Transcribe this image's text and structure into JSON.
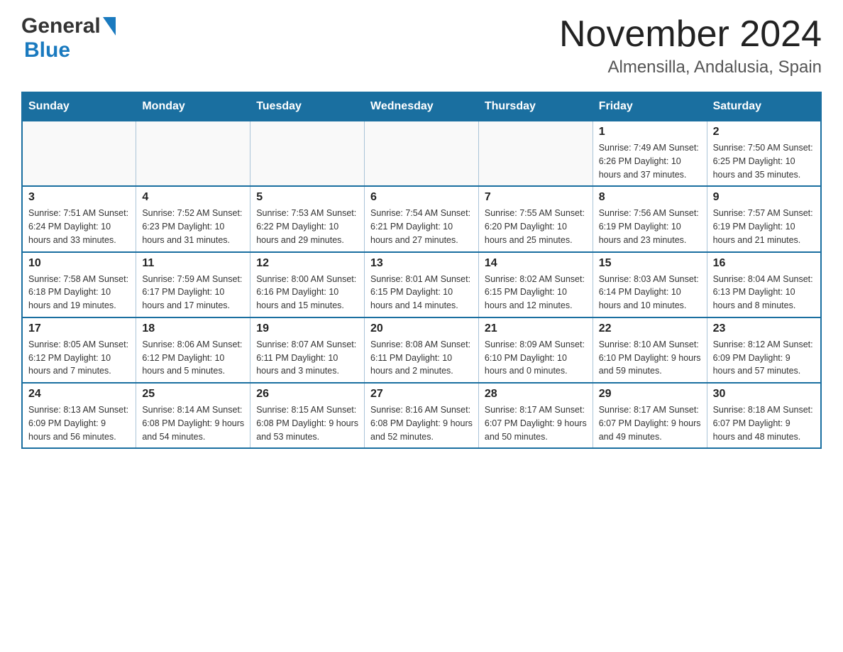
{
  "header": {
    "logo_general": "General",
    "logo_blue": "Blue",
    "title": "November 2024",
    "subtitle": "Almensilla, Andalusia, Spain"
  },
  "weekdays": [
    "Sunday",
    "Monday",
    "Tuesday",
    "Wednesday",
    "Thursday",
    "Friday",
    "Saturday"
  ],
  "weeks": [
    {
      "days": [
        {
          "number": "",
          "info": ""
        },
        {
          "number": "",
          "info": ""
        },
        {
          "number": "",
          "info": ""
        },
        {
          "number": "",
          "info": ""
        },
        {
          "number": "",
          "info": ""
        },
        {
          "number": "1",
          "info": "Sunrise: 7:49 AM\nSunset: 6:26 PM\nDaylight: 10 hours and 37 minutes."
        },
        {
          "number": "2",
          "info": "Sunrise: 7:50 AM\nSunset: 6:25 PM\nDaylight: 10 hours and 35 minutes."
        }
      ]
    },
    {
      "days": [
        {
          "number": "3",
          "info": "Sunrise: 7:51 AM\nSunset: 6:24 PM\nDaylight: 10 hours and 33 minutes."
        },
        {
          "number": "4",
          "info": "Sunrise: 7:52 AM\nSunset: 6:23 PM\nDaylight: 10 hours and 31 minutes."
        },
        {
          "number": "5",
          "info": "Sunrise: 7:53 AM\nSunset: 6:22 PM\nDaylight: 10 hours and 29 minutes."
        },
        {
          "number": "6",
          "info": "Sunrise: 7:54 AM\nSunset: 6:21 PM\nDaylight: 10 hours and 27 minutes."
        },
        {
          "number": "7",
          "info": "Sunrise: 7:55 AM\nSunset: 6:20 PM\nDaylight: 10 hours and 25 minutes."
        },
        {
          "number": "8",
          "info": "Sunrise: 7:56 AM\nSunset: 6:19 PM\nDaylight: 10 hours and 23 minutes."
        },
        {
          "number": "9",
          "info": "Sunrise: 7:57 AM\nSunset: 6:19 PM\nDaylight: 10 hours and 21 minutes."
        }
      ]
    },
    {
      "days": [
        {
          "number": "10",
          "info": "Sunrise: 7:58 AM\nSunset: 6:18 PM\nDaylight: 10 hours and 19 minutes."
        },
        {
          "number": "11",
          "info": "Sunrise: 7:59 AM\nSunset: 6:17 PM\nDaylight: 10 hours and 17 minutes."
        },
        {
          "number": "12",
          "info": "Sunrise: 8:00 AM\nSunset: 6:16 PM\nDaylight: 10 hours and 15 minutes."
        },
        {
          "number": "13",
          "info": "Sunrise: 8:01 AM\nSunset: 6:15 PM\nDaylight: 10 hours and 14 minutes."
        },
        {
          "number": "14",
          "info": "Sunrise: 8:02 AM\nSunset: 6:15 PM\nDaylight: 10 hours and 12 minutes."
        },
        {
          "number": "15",
          "info": "Sunrise: 8:03 AM\nSunset: 6:14 PM\nDaylight: 10 hours and 10 minutes."
        },
        {
          "number": "16",
          "info": "Sunrise: 8:04 AM\nSunset: 6:13 PM\nDaylight: 10 hours and 8 minutes."
        }
      ]
    },
    {
      "days": [
        {
          "number": "17",
          "info": "Sunrise: 8:05 AM\nSunset: 6:12 PM\nDaylight: 10 hours and 7 minutes."
        },
        {
          "number": "18",
          "info": "Sunrise: 8:06 AM\nSunset: 6:12 PM\nDaylight: 10 hours and 5 minutes."
        },
        {
          "number": "19",
          "info": "Sunrise: 8:07 AM\nSunset: 6:11 PM\nDaylight: 10 hours and 3 minutes."
        },
        {
          "number": "20",
          "info": "Sunrise: 8:08 AM\nSunset: 6:11 PM\nDaylight: 10 hours and 2 minutes."
        },
        {
          "number": "21",
          "info": "Sunrise: 8:09 AM\nSunset: 6:10 PM\nDaylight: 10 hours and 0 minutes."
        },
        {
          "number": "22",
          "info": "Sunrise: 8:10 AM\nSunset: 6:10 PM\nDaylight: 9 hours and 59 minutes."
        },
        {
          "number": "23",
          "info": "Sunrise: 8:12 AM\nSunset: 6:09 PM\nDaylight: 9 hours and 57 minutes."
        }
      ]
    },
    {
      "days": [
        {
          "number": "24",
          "info": "Sunrise: 8:13 AM\nSunset: 6:09 PM\nDaylight: 9 hours and 56 minutes."
        },
        {
          "number": "25",
          "info": "Sunrise: 8:14 AM\nSunset: 6:08 PM\nDaylight: 9 hours and 54 minutes."
        },
        {
          "number": "26",
          "info": "Sunrise: 8:15 AM\nSunset: 6:08 PM\nDaylight: 9 hours and 53 minutes."
        },
        {
          "number": "27",
          "info": "Sunrise: 8:16 AM\nSunset: 6:08 PM\nDaylight: 9 hours and 52 minutes."
        },
        {
          "number": "28",
          "info": "Sunrise: 8:17 AM\nSunset: 6:07 PM\nDaylight: 9 hours and 50 minutes."
        },
        {
          "number": "29",
          "info": "Sunrise: 8:17 AM\nSunset: 6:07 PM\nDaylight: 9 hours and 49 minutes."
        },
        {
          "number": "30",
          "info": "Sunrise: 8:18 AM\nSunset: 6:07 PM\nDaylight: 9 hours and 48 minutes."
        }
      ]
    }
  ]
}
